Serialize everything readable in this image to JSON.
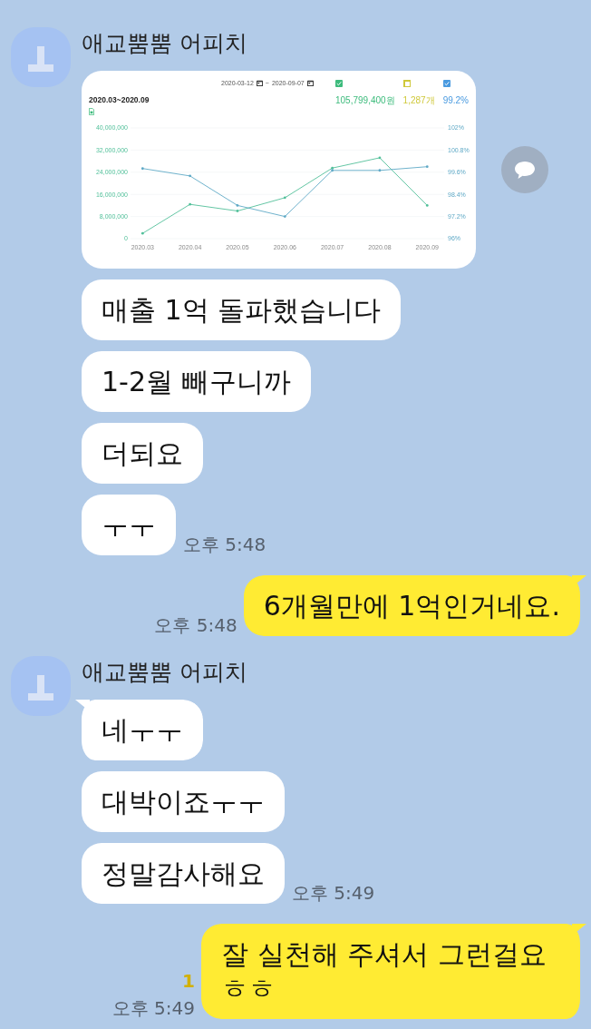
{
  "chat": [
    {
      "kind": "received",
      "sender": "애교뿜뿜 어피치",
      "messages": [
        {
          "kind": "dashboard",
          "dashboard": {
            "start_date": "2020-03-12",
            "date_separator": "~",
            "end_date": "2020-09-07",
            "period": "2020.03~2020.09",
            "metrics": [
              {
                "checked": true,
                "color": "#3dbb7c",
                "value": "105,799,400원"
              },
              {
                "checked": false,
                "color": "#cfc83a",
                "value": "1,287개"
              },
              {
                "checked": true,
                "color": "#4b9be0",
                "value": "99.2%"
              }
            ],
            "chart_data": {
              "type": "line",
              "grid": true,
              "categories": [
                "2020.03",
                "2020.04",
                "2020.05",
                "2020.06",
                "2020.07",
                "2020.08",
                "2020.09"
              ],
              "ylim": [
                0,
                40000000
              ],
              "yticks": [
                {
                  "value": 0,
                  "label": "0"
                },
                {
                  "value": 8000000,
                  "label": "8,000,000"
                },
                {
                  "value": 16000000,
                  "label": "16,000,000"
                },
                {
                  "value": 24000000,
                  "label": "24,000,000"
                },
                {
                  "value": 32000000,
                  "label": "32,000,000"
                },
                {
                  "value": 40000000,
                  "label": "40,000,000"
                }
              ],
              "y2lim": [
                96,
                102
              ],
              "y2ticks": [
                {
                  "value": 96,
                  "label": "96%"
                },
                {
                  "value": 97.2,
                  "label": "97.2%"
                },
                {
                  "value": 98.4,
                  "label": "98.4%"
                },
                {
                  "value": 99.6,
                  "label": "99.6%"
                },
                {
                  "value": 100.8,
                  "label": "100.8%"
                },
                {
                  "value": 102,
                  "label": "102%"
                }
              ],
              "series": [
                {
                  "color": "#52c09a",
                  "values": [
                    1900000,
                    12400000,
                    10000000,
                    14800000,
                    25500000,
                    29200000,
                    12000000
                  ]
                },
                {
                  "color": "#5fa9c6",
                  "axis": "y2",
                  "values": [
                    99.8,
                    99.4,
                    97.8,
                    97.2,
                    99.7,
                    99.7,
                    99.9
                  ]
                }
              ]
            }
          }
        },
        {
          "kind": "text",
          "text": "매출 1억 돌파했습니다"
        },
        {
          "kind": "text",
          "text": "1-2월 빼구니까"
        },
        {
          "kind": "text",
          "text": "더되요"
        },
        {
          "kind": "text",
          "text": "ㅜㅜ",
          "time": "오후 5:48"
        }
      ]
    },
    {
      "kind": "sent",
      "messages": [
        {
          "kind": "text",
          "text": "6개월만에 1억인거네요.",
          "time": "오후 5:48"
        }
      ]
    },
    {
      "kind": "received",
      "sender": "애교뿜뿜 어피치",
      "messages": [
        {
          "kind": "text",
          "text": "네ㅜㅜ"
        },
        {
          "kind": "text",
          "text": "대박이죠ㅜㅜ"
        },
        {
          "kind": "text",
          "text": "정말감사해요",
          "time": "오후 5:49"
        }
      ]
    },
    {
      "kind": "sent",
      "messages": [
        {
          "kind": "text",
          "text": "잘 실천해 주셔서 그런걸요 ㅎㅎ",
          "unread": "1",
          "time": "오후 5:49"
        }
      ]
    }
  ]
}
